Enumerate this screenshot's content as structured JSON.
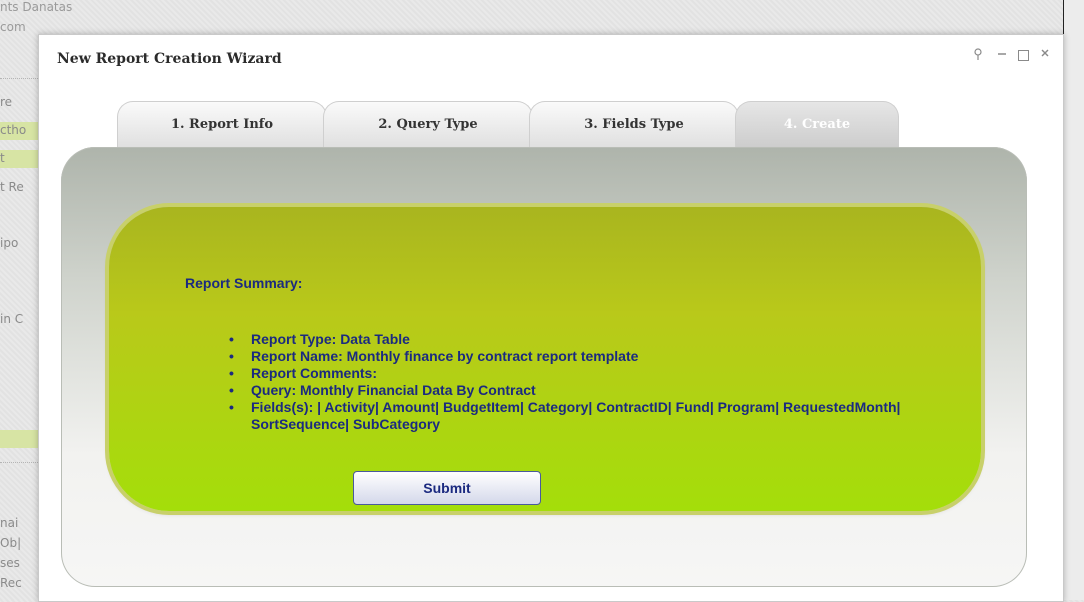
{
  "background": {
    "title_fragment_1": "nts Danatas",
    "title_fragment_2": "com",
    "sidebar_fragments": [
      "re",
      "ctho",
      "t",
      "t Re",
      "ipo",
      "",
      "in C",
      "",
      "nai",
      "Ob|",
      "ses",
      "Rec"
    ]
  },
  "dialog": {
    "title": "New Report Creation Wizard",
    "controls": {
      "pin_icon": "pin-icon",
      "minimize_icon": "minimize-icon",
      "maximize_icon": "maximize-icon",
      "close_icon": "close-icon"
    }
  },
  "tabs": [
    {
      "label": "1. Report Info"
    },
    {
      "label": "2. Query Type"
    },
    {
      "label": "3. Fields Type"
    },
    {
      "label": "4. Create"
    }
  ],
  "summary": {
    "title": "Report Summary:",
    "items": [
      "Report Type: Data Table",
      "Report Name: Monthly finance by contract report template",
      "Report Comments:",
      "Query: Monthly Financial Data By Contract",
      "Fields(s): | Activity| Amount| BudgetItem| Category| ContractID| Fund| Program| RequestedMonth| SortSequence| SubCategory"
    ],
    "submit_label": "Submit"
  },
  "colors": {
    "accent_text": "#1b2a80",
    "card_green": "#a4de0a"
  }
}
